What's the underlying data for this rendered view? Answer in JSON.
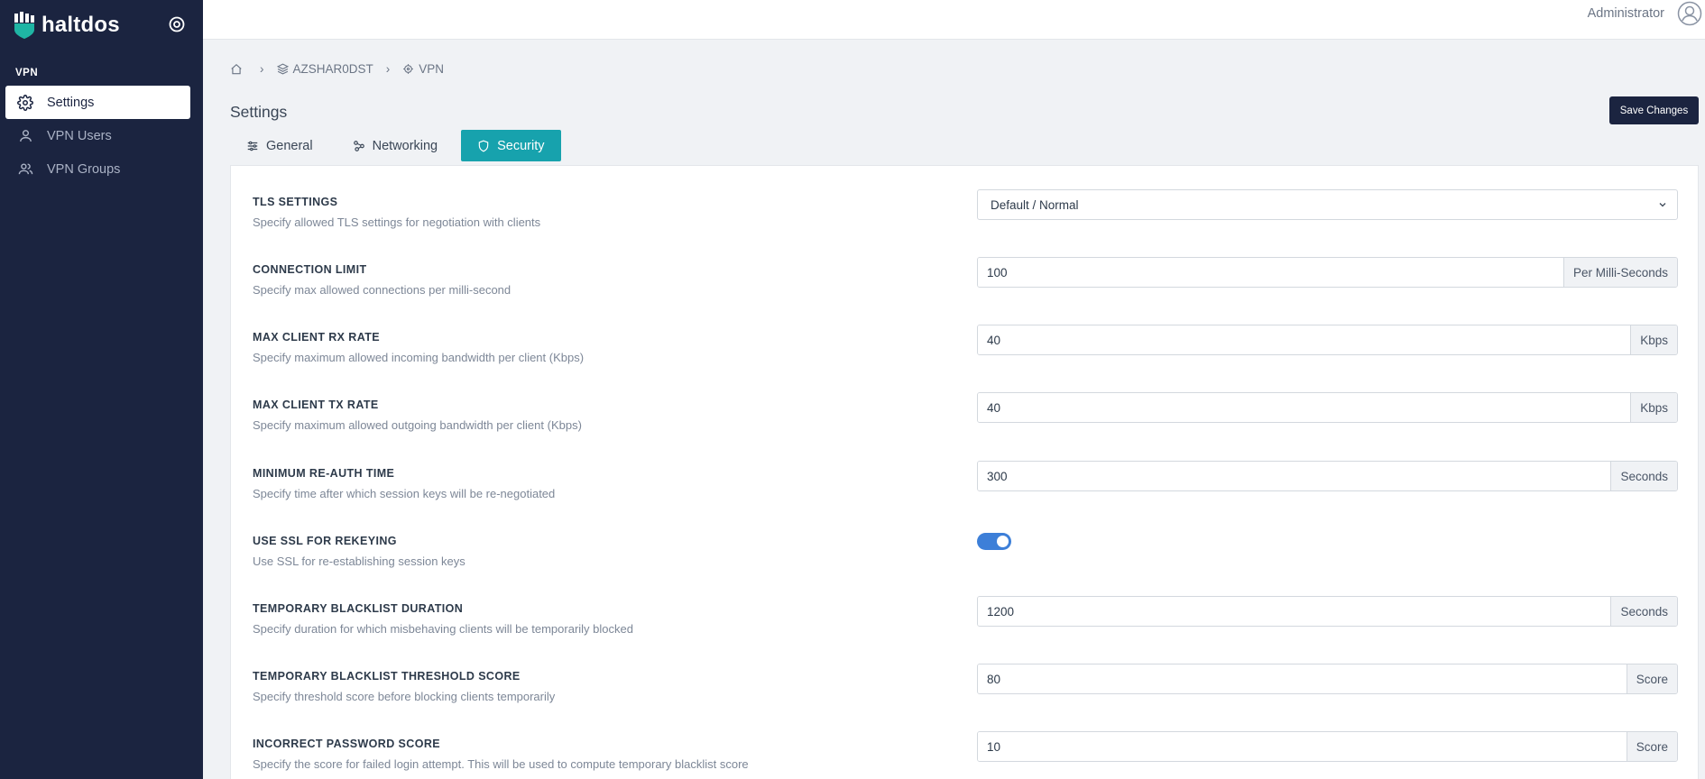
{
  "brand": {
    "name": "haltdos"
  },
  "sidebar": {
    "section": "VPN",
    "items": [
      {
        "label": "Settings",
        "icon": "gear-icon"
      },
      {
        "label": "VPN Users",
        "icon": "user-icon"
      },
      {
        "label": "VPN Groups",
        "icon": "users-icon"
      }
    ]
  },
  "topbar": {
    "user": "Administrator"
  },
  "breadcrumb": {
    "node": "AZSHAR0DST",
    "page": "VPN"
  },
  "page": {
    "title": "Settings",
    "save_label": "Save Changes"
  },
  "tabs": [
    {
      "label": "General",
      "icon": "sliders-icon"
    },
    {
      "label": "Networking",
      "icon": "network-icon"
    },
    {
      "label": "Security",
      "icon": "shield-icon"
    }
  ],
  "settings": [
    {
      "label": "TLS SETTINGS",
      "desc": "Specify allowed TLS settings for negotiation with clients",
      "type": "select",
      "value": "Default / Normal"
    },
    {
      "label": "CONNECTION LIMIT",
      "desc": "Specify max allowed connections per milli-second",
      "type": "input",
      "value": "100",
      "unit": "Per Milli-Seconds"
    },
    {
      "label": "MAX CLIENT RX RATE",
      "desc": "Specify maximum allowed incoming bandwidth per client (Kbps)",
      "type": "input",
      "value": "40",
      "unit": "Kbps"
    },
    {
      "label": "MAX CLIENT TX RATE",
      "desc": "Specify maximum allowed outgoing bandwidth per client (Kbps)",
      "type": "input",
      "value": "40",
      "unit": "Kbps"
    },
    {
      "label": "MINIMUM RE-AUTH TIME",
      "desc": "Specify time after which session keys will be re-negotiated",
      "type": "input",
      "value": "300",
      "unit": "Seconds"
    },
    {
      "label": "USE SSL FOR REKEYING",
      "desc": "Use SSL for re-establishing session keys",
      "type": "toggle",
      "value": true
    },
    {
      "label": "TEMPORARY BLACKLIST DURATION",
      "desc": "Specify duration for which misbehaving clients will be temporarily blocked",
      "type": "input",
      "value": "1200",
      "unit": "Seconds"
    },
    {
      "label": "TEMPORARY BLACKLIST THRESHOLD SCORE",
      "desc": "Specify threshold score before blocking clients temporarily",
      "type": "input",
      "value": "80",
      "unit": "Score"
    },
    {
      "label": "INCORRECT PASSWORD SCORE",
      "desc": "Specify the score for failed login attempt. This will be used to compute temporary blacklist score",
      "type": "input",
      "value": "10",
      "unit": "Score"
    }
  ]
}
